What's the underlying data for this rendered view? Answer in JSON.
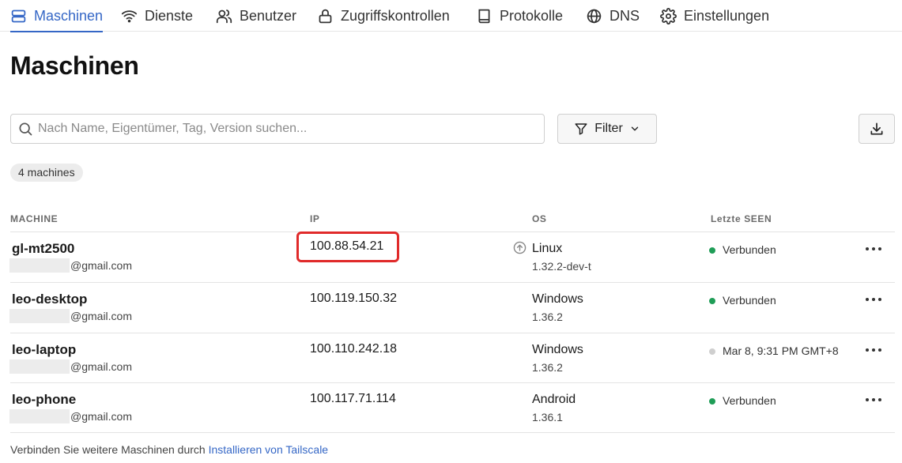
{
  "nav": {
    "tabs": [
      {
        "label": "Maschinen",
        "icon": "server-icon",
        "active": true
      },
      {
        "label": "Dienste",
        "icon": "wifi-icon",
        "active": false
      },
      {
        "label": "Benutzer",
        "icon": "users-icon",
        "active": false
      },
      {
        "label": "Zugriffskontrollen",
        "icon": "lock-icon",
        "active": false
      },
      {
        "label": "Protokolle",
        "icon": "book-icon",
        "active": false
      },
      {
        "label": "DNS",
        "icon": "globe-icon",
        "active": false
      },
      {
        "label": "Einstellungen",
        "icon": "gear-icon",
        "active": false
      }
    ]
  },
  "page": {
    "title": "Maschinen"
  },
  "search": {
    "placeholder": "Nach Name, Eigentümer, Tag, Version suchen..."
  },
  "filter": {
    "label": "Filter"
  },
  "count_badge": "4 machines",
  "table": {
    "headers": {
      "machine": "MACHINE",
      "ip": "IP",
      "os": "OS",
      "last_seen": "Letzte SEEN"
    },
    "rows": [
      {
        "name": "gl-mt2500",
        "owner": "@gmail.com",
        "ip": "100.88.54.21",
        "os": "Linux",
        "os_version": "1.32.2-dev-t",
        "status": "Verbunden",
        "status_color": "#1f9d57",
        "update_available": true,
        "highlighted": true
      },
      {
        "name": "leo-desktop",
        "owner": "@gmail.com",
        "ip": "100.119.150.32",
        "os": "Windows",
        "os_version": "1.36.2",
        "status": "Verbunden",
        "status_color": "#1f9d57",
        "update_available": false,
        "highlighted": false
      },
      {
        "name": "leo-laptop",
        "owner": "@gmail.com",
        "ip": "100.110.242.18",
        "os": "Windows",
        "os_version": "1.36.2",
        "status": "Mar 8, 9:31 PM GMT+8",
        "status_color": "#cfcfcf",
        "update_available": false,
        "highlighted": false
      },
      {
        "name": "leo-phone",
        "owner": "@gmail.com",
        "ip": "100.117.71.114",
        "os": "Android",
        "os_version": "1.36.1",
        "status": "Verbunden",
        "status_color": "#1f9d57",
        "update_available": false,
        "highlighted": false
      }
    ]
  },
  "footer": {
    "text": "Verbinden Sie weitere Maschinen durch ",
    "link": "Installieren von Tailscale"
  },
  "colors": {
    "accent": "#3567c6",
    "highlight": "#e02a2a"
  }
}
